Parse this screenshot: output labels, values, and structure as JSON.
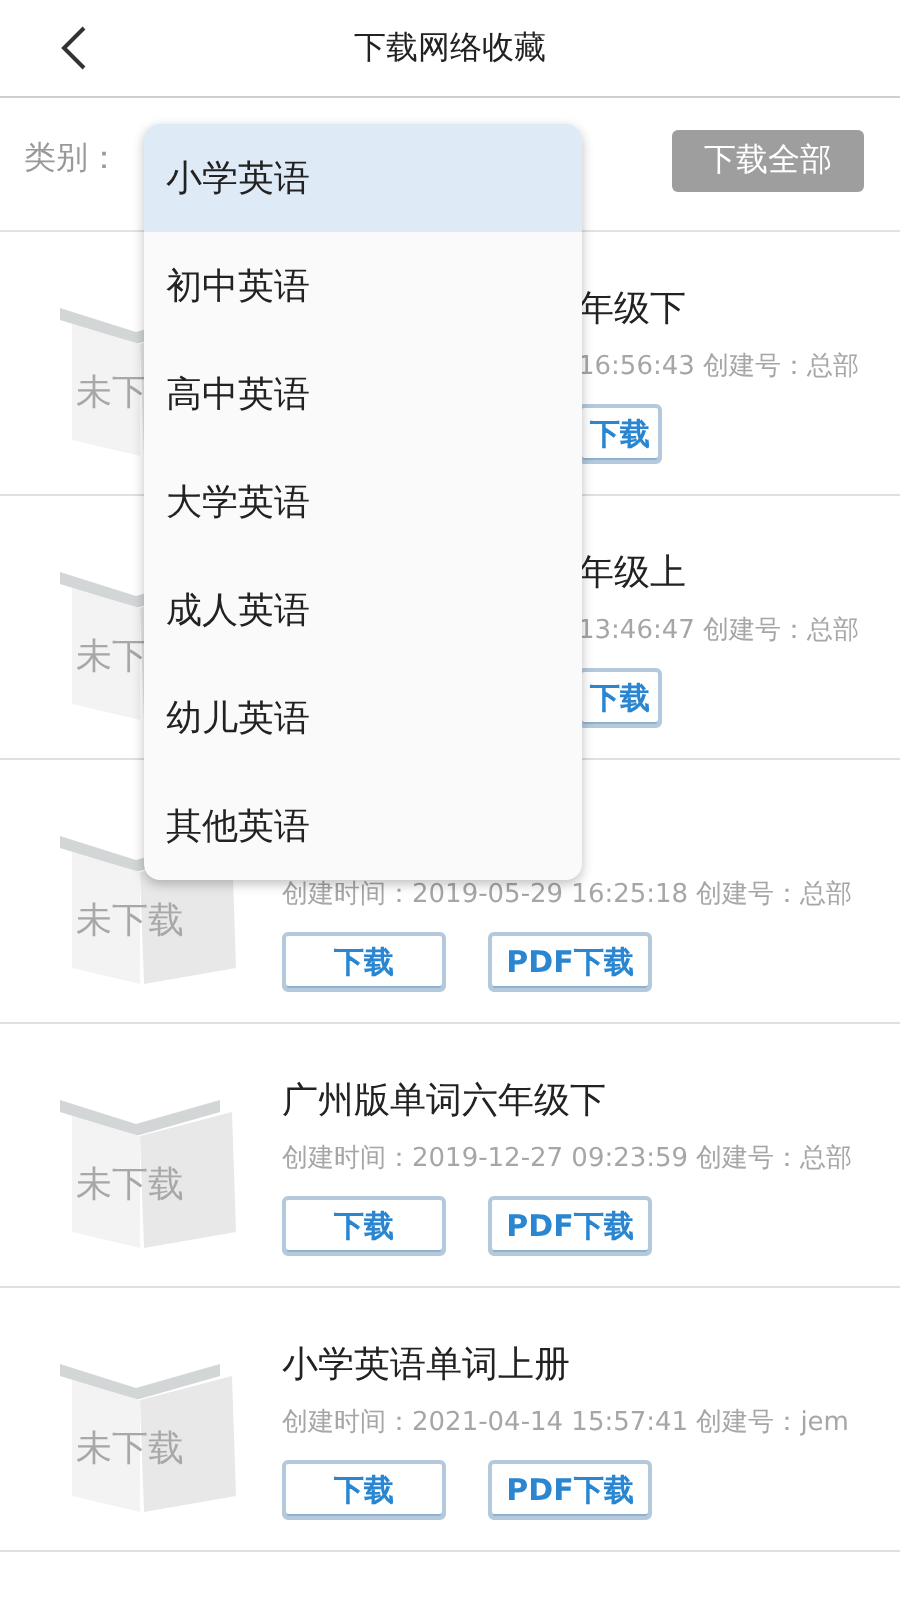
{
  "header": {
    "title": "下载网络收藏"
  },
  "filter": {
    "label": "类别：",
    "download_all": {
      "label": "下载全部",
      "disabled": true
    }
  },
  "dropdown": {
    "options": [
      {
        "label": "小学英语",
        "selected": true
      },
      {
        "label": "初中英语",
        "selected": false
      },
      {
        "label": "高中英语",
        "selected": false
      },
      {
        "label": "大学英语",
        "selected": false
      },
      {
        "label": "成人英语",
        "selected": false
      },
      {
        "label": "幼儿英语",
        "selected": false
      },
      {
        "label": "其他英语",
        "selected": false
      }
    ]
  },
  "items": [
    {
      "kind": "partial",
      "cover": "未下",
      "title": "年级下",
      "meta": "16:56:43 创建号：总部",
      "buttons": [
        "下载"
      ]
    },
    {
      "kind": "partial",
      "cover": "未下",
      "title": "年级上",
      "meta": "13:46:47 创建号：总部",
      "buttons": [
        "下载"
      ]
    },
    {
      "kind": "full",
      "cover": "未下载",
      "meta": "创建时间：2019-05-29 16:25:18 创建号：总部",
      "buttons": [
        "下载",
        "PDF下载"
      ]
    },
    {
      "kind": "full",
      "cover": "未下载",
      "title": "广州版单词六年级下",
      "meta": "创建时间：2019-12-27 09:23:59 创建号：总部",
      "buttons": [
        "下载",
        "PDF下载"
      ]
    },
    {
      "kind": "full",
      "cover": "未下载",
      "title": "小学英语单词上册",
      "meta": "创建时间：2021-04-14 15:57:41 创建号：jem",
      "buttons": [
        "下载",
        "PDF下载"
      ]
    }
  ]
}
